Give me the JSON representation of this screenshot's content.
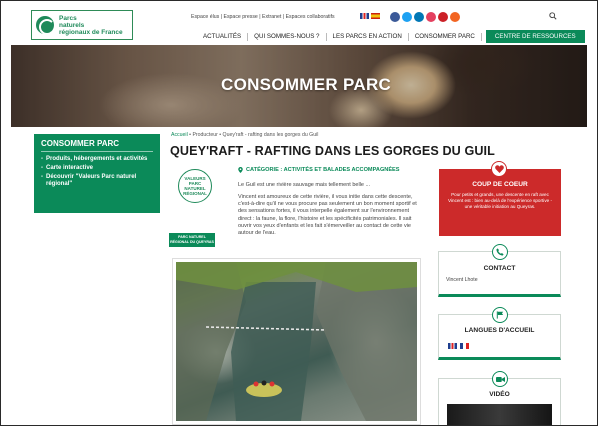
{
  "header": {
    "logo": {
      "line1": "Parcs",
      "line2": "naturels",
      "line3": "régionaux de France"
    },
    "top_links": "Espace élus | Espace presse | Extranet | Espaces collaboratifs",
    "nav": [
      "ACTUALITÉS",
      "QUI SOMMES-NOUS ?",
      "LES PARCS EN ACTION",
      "CONSOMMER PARC"
    ],
    "nav_cta": "CENTRE DE RESSOURCES",
    "social_colors": [
      "#3b5998",
      "#1da1f2",
      "#0077b5",
      "#e4405f",
      "#cb2027",
      "#f26522"
    ]
  },
  "banner": {
    "title": "CONSOMMER PARC"
  },
  "sidebar": {
    "title": "CONSOMMER PARC",
    "items": [
      {
        "label": "Produits, hébergements et activités"
      },
      {
        "label": "Carte interactive"
      },
      {
        "label": "Découvrir \"Valeurs Parc naturel régional\""
      }
    ]
  },
  "breadcrumb": {
    "home": "Accueil",
    "sep1": " • ",
    "section": "Producteur",
    "sep2": " • ",
    "current": "Quey'raft - rafting dans les gorges du Guil"
  },
  "content": {
    "title": "QUEY'RAFT - RAFTING DANS LES GORGES DU GUIL",
    "category": "CATÉGORIE : ACTIVITÉS ET BALADES ACCOMPAGNÉES",
    "intro": "Le Guil est une rivière sauvage mais tellement belle ...",
    "description": "Vincent est amoureux de cette rivière, il vous initie dans cette descente, c'est-à-dire qu'il ne vous procure pas seulement un bon moment sportif et des sensations fortes, il vous interpelle également sur l'environnement direct : la faune, la flore, l'histoire et les spécificités patrimoniales. Il sait ouvrir vos yeux d'enfants et les fait s'émerveiller au contact de cette vie autour de l'eau.",
    "badge": {
      "line1": "VALEURS",
      "line2": "PARC",
      "line3": "NATUREL",
      "line4": "RÉGIONAL"
    },
    "badge_caption": "PARC NATUREL RÉGIONAL DU QUEYRAS"
  },
  "right": {
    "coeur": {
      "title": "COUP DE COEUR",
      "text": "Pour petits et grands, une descente en raft avec Vincent est : bien au-delà de l'expérience sportive - une véritable initiation au Queyras."
    },
    "contact": {
      "title": "CONTACT",
      "name": "Vincent Lhote"
    },
    "langues": {
      "title": "LANGUES D'ACCUEIL"
    },
    "video": {
      "title": "VIDÉO"
    }
  },
  "colors": {
    "brand_green": "#0b8a59",
    "coeur_red": "#cc2a2a"
  }
}
